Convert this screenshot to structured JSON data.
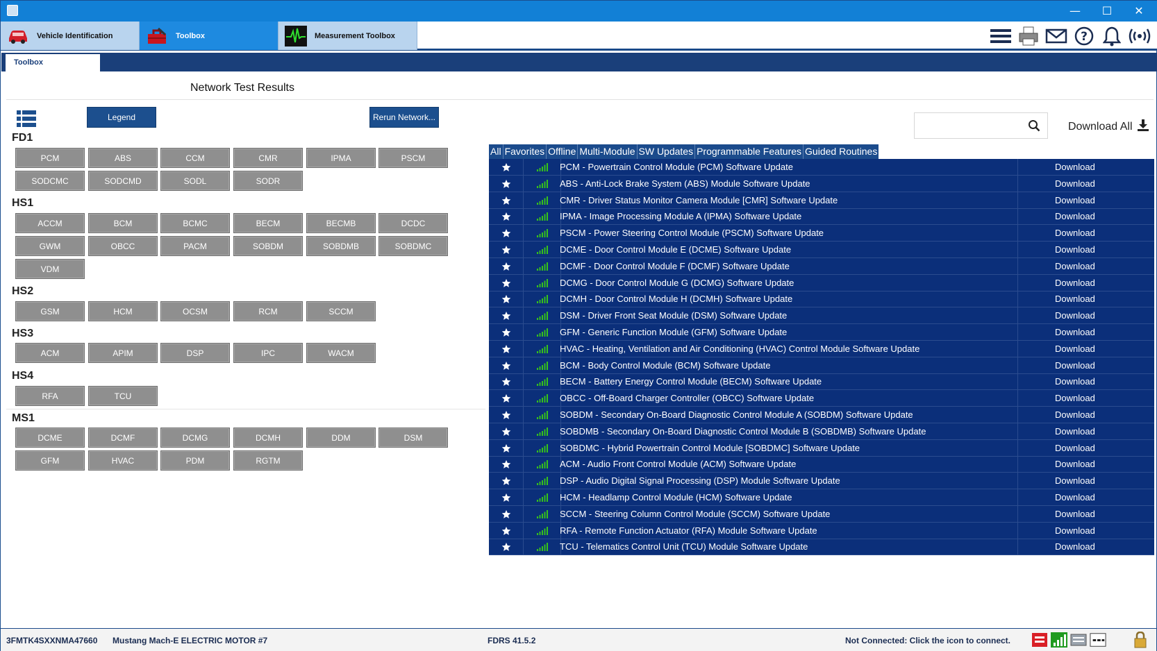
{
  "window": {
    "minimize": "—",
    "maximize": "☐",
    "close": "✕"
  },
  "app_tabs": [
    {
      "label": "Vehicle Identification"
    },
    {
      "label": "Toolbox"
    },
    {
      "label": "Measurement Toolbox"
    }
  ],
  "sub_tab": "Toolbox",
  "page_title": "Network Test Results",
  "buttons": {
    "legend": "Legend",
    "rerun": "Rerun Network..."
  },
  "groups": {
    "fd1": {
      "label": "FD1",
      "modules": [
        "PCM",
        "ABS",
        "CCM",
        "CMR",
        "IPMA",
        "PSCM",
        "SODCMC",
        "SODCMD",
        "SODL",
        "SODR"
      ]
    },
    "hs1": {
      "label": "HS1",
      "modules": [
        "ACCM",
        "BCM",
        "BCMC",
        "BECM",
        "BECMB",
        "DCDC",
        "GWM",
        "OBCC",
        "PACM",
        "SOBDM",
        "SOBDMB",
        "SOBDMC",
        "VDM"
      ]
    },
    "hs2": {
      "label": "HS2",
      "modules": [
        "GSM",
        "HCM",
        "OCSM",
        "RCM",
        "SCCM"
      ]
    },
    "hs3": {
      "label": "HS3",
      "modules": [
        "ACM",
        "APIM",
        "DSP",
        "IPC",
        "WACM"
      ]
    },
    "hs4": {
      "label": "HS4",
      "modules": [
        "RFA",
        "TCU"
      ]
    },
    "ms1": {
      "label": "MS1",
      "modules": [
        "DCME",
        "DCMF",
        "DCMG",
        "DCMH",
        "DDM",
        "DSM",
        "GFM",
        "HVAC",
        "PDM",
        "RGTM"
      ]
    }
  },
  "search": {
    "placeholder": ""
  },
  "download_all": "Download All",
  "filters": [
    "All",
    "Favorites",
    "Offline",
    "Multi-Module",
    "SW Updates",
    "Programmable Features",
    "Guided Routines"
  ],
  "updates": [
    {
      "desc": "PCM - Powertrain Control Module (PCM) Software Update",
      "action": "Download"
    },
    {
      "desc": "ABS - Anti-Lock Brake System (ABS) Module Software Update",
      "action": "Download"
    },
    {
      "desc": "CMR - Driver Status Monitor Camera Module [CMR] Software Update",
      "action": "Download"
    },
    {
      "desc": "IPMA - Image Processing Module A (IPMA) Software Update",
      "action": "Download"
    },
    {
      "desc": "PSCM - Power Steering Control Module (PSCM) Software Update",
      "action": "Download"
    },
    {
      "desc": "DCME - Door Control Module E (DCME) Software Update",
      "action": "Download"
    },
    {
      "desc": "DCMF - Door Control Module F (DCMF) Software Update",
      "action": "Download"
    },
    {
      "desc": "DCMG - Door Control Module G (DCMG) Software Update",
      "action": "Download"
    },
    {
      "desc": "DCMH - Door Control Module H (DCMH) Software Update",
      "action": "Download"
    },
    {
      "desc": "DSM - Driver Front Seat Module (DSM) Software Update",
      "action": "Download"
    },
    {
      "desc": "GFM - Generic Function Module (GFM) Software Update",
      "action": "Download"
    },
    {
      "desc": "HVAC - Heating, Ventilation and Air Conditioning (HVAC) Control Module Software Update",
      "action": "Download"
    },
    {
      "desc": "BCM - Body Control Module (BCM) Software Update",
      "action": "Download"
    },
    {
      "desc": "BECM - Battery Energy Control Module (BECM) Software Update",
      "action": "Download"
    },
    {
      "desc": "OBCC - Off-Board Charger Controller (OBCC) Software Update",
      "action": "Download"
    },
    {
      "desc": "SOBDM - Secondary On-Board Diagnostic Control Module A (SOBDM) Software Update",
      "action": "Download"
    },
    {
      "desc": "SOBDMB - Secondary On-Board Diagnostic Control Module B (SOBDMB) Software Update",
      "action": "Download"
    },
    {
      "desc": "SOBDMC - Hybrid Powertrain Control Module [SOBDMC] Software Update",
      "action": "Download"
    },
    {
      "desc": "ACM - Audio Front Control Module (ACM) Software Update",
      "action": "Download"
    },
    {
      "desc": "DSP - Audio Digital Signal Processing (DSP) Module Software Update",
      "action": "Download"
    },
    {
      "desc": "HCM - Headlamp Control Module (HCM) Software Update",
      "action": "Download"
    },
    {
      "desc": "SCCM - Steering Column Control Module (SCCM) Software Update",
      "action": "Download"
    },
    {
      "desc": "RFA - Remote Function Actuator (RFA) Module Software Update",
      "action": "Download"
    },
    {
      "desc": "TCU - Telematics Control Unit (TCU) Module Software Update",
      "action": "Download"
    }
  ],
  "status": {
    "vin": "3FMTK4SXXNMA47660",
    "vehicle": "Mustang Mach-E ELECTRIC MOTOR #7",
    "version": "FDRS 41.5.2",
    "connection": "Not Connected: Click the icon to connect."
  },
  "colors": {
    "accent": "#1280d6",
    "table_bg": "#0b2f7a",
    "module_button": "#8f8f8f",
    "signal_green": "#36c21a"
  }
}
